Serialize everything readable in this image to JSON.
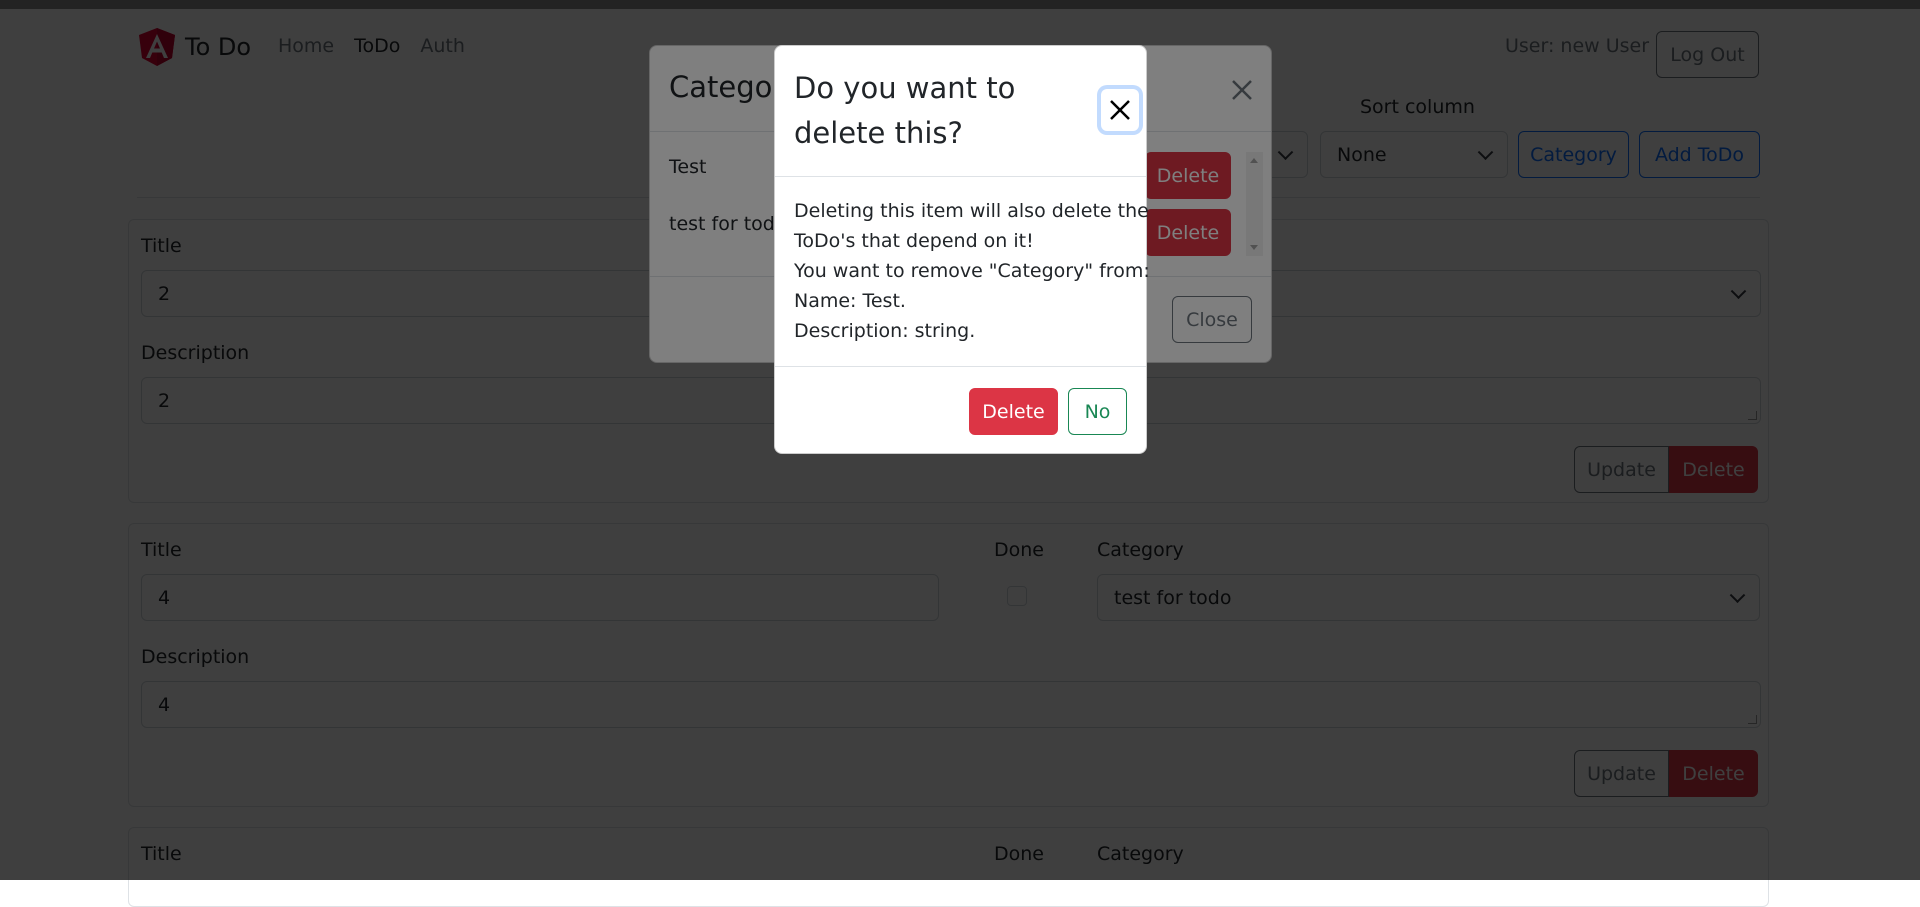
{
  "navbar": {
    "brand": "To Do",
    "links": [
      "Home",
      "ToDo",
      "Auth"
    ],
    "active_link": "ToDo",
    "user_label": "User: new User",
    "logout_label": "Log Out"
  },
  "toolbar": {
    "sort_label": "Sort column",
    "sort_value": "None",
    "category_label": "Category",
    "add_todo_label": "Add ToDo"
  },
  "todos": [
    {
      "title_label": "Title",
      "title_value": "2",
      "description_label": "Description",
      "description_value": "2",
      "update_label": "Update",
      "delete_label": "Delete"
    },
    {
      "title_label": "Title",
      "title_value": "4",
      "done_label": "Done",
      "done": false,
      "category_label": "Category",
      "category_value": "test for todo",
      "description_label": "Description",
      "description_value": "4",
      "update_label": "Update",
      "delete_label": "Delete"
    },
    {
      "title_label": "Title",
      "done_label": "Done",
      "category_label": "Category"
    }
  ],
  "category_modal": {
    "title": "Categor",
    "items": [
      {
        "name": "Test",
        "delete_label": "Delete"
      },
      {
        "name": "test for todo",
        "delete_label": "Delete"
      }
    ],
    "close_label": "Close"
  },
  "confirm_modal": {
    "title": "Do you want to delete this?",
    "body_lines": [
      "Deleting this item will also delete the",
      "ToDo's that depend on it!",
      "You want to remove \"Category\" from:",
      "Name: Test.",
      "Description: string."
    ],
    "delete_label": "Delete",
    "no_label": "No"
  },
  "colors": {
    "primary": "#0d6efd",
    "danger": "#dc3545",
    "success": "#198754",
    "secondary": "#6c757d",
    "logo": "#dd0031"
  }
}
